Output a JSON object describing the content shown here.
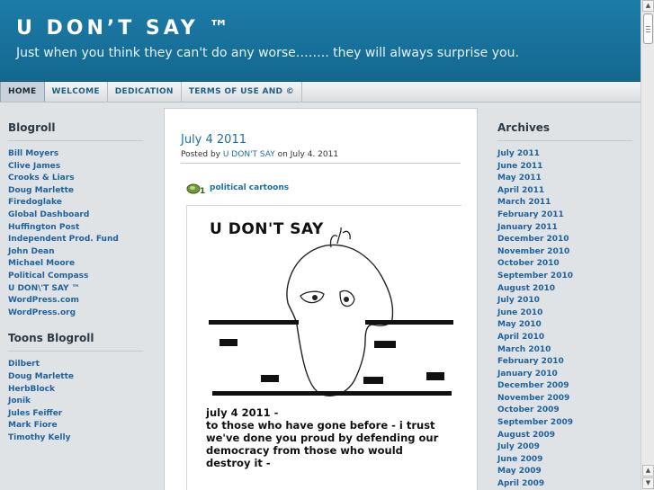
{
  "header": {
    "title": "U DON’T SAY ™",
    "tagline": "Just when you think they can't do any worse…….. they will always surprise you."
  },
  "nav": [
    "HOME",
    "WELCOME",
    "DEDICATION",
    "TERMS OF USE AND ©"
  ],
  "blogroll": {
    "title": "Blogroll",
    "items": [
      "Bill Moyers",
      "Clive James",
      "Crooks & Liars",
      "Doug Marlette",
      "Firedoglake",
      "Global Dashboard",
      "Huffington Post",
      "Independent Prod. Fund",
      "John Dean",
      "Michael Moore",
      "Political Compass",
      "U DON\\'T SAY ™",
      "WordPress.com",
      "WordPress.org"
    ]
  },
  "toons": {
    "title": "Toons Blogroll",
    "items": [
      "Dilbert",
      "Doug Marlette",
      "HerbBlock",
      "Jonik",
      "Jules Feiffer",
      "Mark Fiore",
      "Timothy Kelly"
    ]
  },
  "archives": {
    "title": "Archives",
    "items": [
      "July 2011",
      "June 2011",
      "May 2011",
      "April 2011",
      "March 2011",
      "February 2011",
      "January 2011",
      "December 2010",
      "November 2010",
      "October 2010",
      "September 2010",
      "August 2010",
      "July 2010",
      "June 2010",
      "May 2010",
      "April 2010",
      "March 2010",
      "February 2010",
      "January 2010",
      "December 2009",
      "November 2009",
      "October 2009",
      "September 2009",
      "August 2009",
      "July 2009",
      "June 2009",
      "May 2009",
      "April 2009"
    ]
  },
  "post": {
    "title": "July 4 2011",
    "posted_by": "Posted by",
    "author": "U DON'T SAY",
    "date_text": "on July 4. 2011",
    "category": "political cartoons",
    "category_icon": "folder-icon"
  },
  "cartoon": {
    "title": "U DON'T SAY",
    "caption_lines": [
      "july 4 2011 -",
      "to those who have gone before - i trust",
      "we've done you proud by defending our",
      "democracy from those who would",
      "destroy it -"
    ]
  },
  "colors": {
    "header_bg": "#13688f",
    "link": "#1f62a0",
    "post_title": "#1a6fa8"
  }
}
